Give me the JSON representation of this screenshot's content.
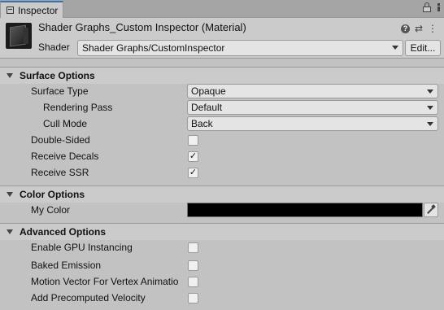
{
  "tab": {
    "label": "Inspector"
  },
  "header": {
    "title": "Shader Graphs_Custom Inspector (Material)",
    "shader_label": "Shader",
    "shader_value": "Shader Graphs/CustomInspector",
    "edit_label": "Edit..."
  },
  "sections": {
    "surface": {
      "title": "Surface Options",
      "surface_type_label": "Surface Type",
      "surface_type_value": "Opaque",
      "rendering_pass_label": "Rendering Pass",
      "rendering_pass_value": "Default",
      "cull_mode_label": "Cull Mode",
      "cull_mode_value": "Back",
      "double_sided_label": "Double-Sided",
      "double_sided_checked": false,
      "receive_decals_label": "Receive Decals",
      "receive_decals_checked": true,
      "receive_ssr_label": "Receive SSR",
      "receive_ssr_checked": true
    },
    "color": {
      "title": "Color Options",
      "my_color_label": "My Color",
      "my_color_value": "#000000"
    },
    "advanced": {
      "title": "Advanced Options",
      "gpu_instancing_label": "Enable GPU Instancing",
      "gpu_instancing_checked": false,
      "baked_emission_label": "Baked Emission",
      "baked_emission_checked": false,
      "motion_vector_label": "Motion Vector For Vertex Animatio",
      "motion_vector_checked": false,
      "precomputed_velocity_label": "Add Precomputed Velocity",
      "precomputed_velocity_checked": false
    }
  },
  "icons": {
    "tab": "inspector-icon",
    "lock": "lock-icon",
    "menu": "kebab-menu-icon",
    "help": "help-icon",
    "preset": "preset-icon",
    "dots": "dots-icon",
    "material": "material-preview-icon",
    "picker": "eyedropper-icon"
  },
  "colors": {
    "accent": "#3a72b0",
    "panel": "#cbcbcb",
    "background": "#c2c2c2"
  }
}
